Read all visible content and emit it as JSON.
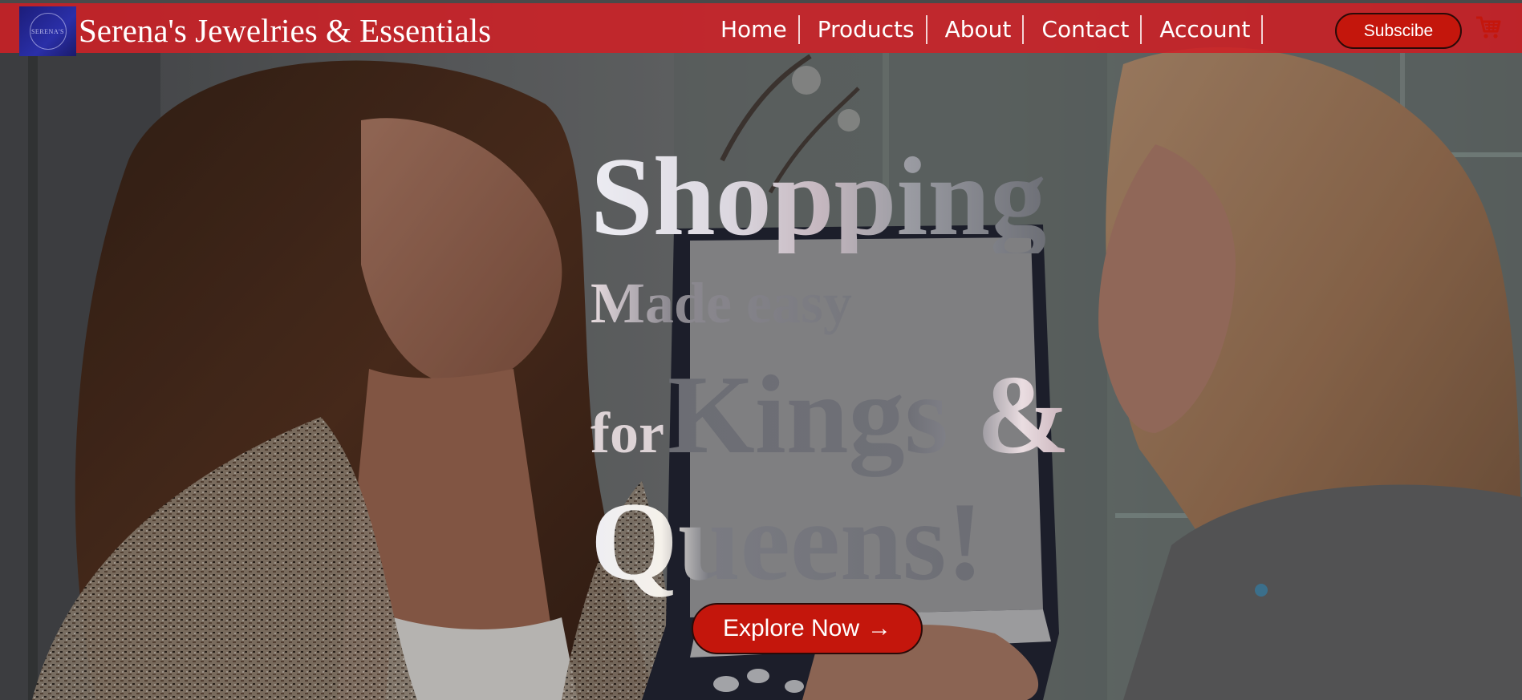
{
  "header": {
    "brand_name": "Serena's Jewelries & Essentials",
    "logo_text": "SERENA'S",
    "accent_color": "#ce2026"
  },
  "nav": {
    "items": [
      {
        "label": "Home"
      },
      {
        "label": "Products"
      },
      {
        "label": "About"
      },
      {
        "label": "Contact"
      },
      {
        "label": "Account"
      }
    ],
    "subscribe_label": "Subscibe",
    "cart_icon": "shopping-cart-icon"
  },
  "hero": {
    "line1": "Shopping",
    "line2": "Made easy",
    "line3_small": "for",
    "line3_big": "Kings &",
    "line4": "Queens!",
    "cta_label": "Explore Now",
    "cta_icon": "→",
    "button_color": "#c4160c"
  }
}
